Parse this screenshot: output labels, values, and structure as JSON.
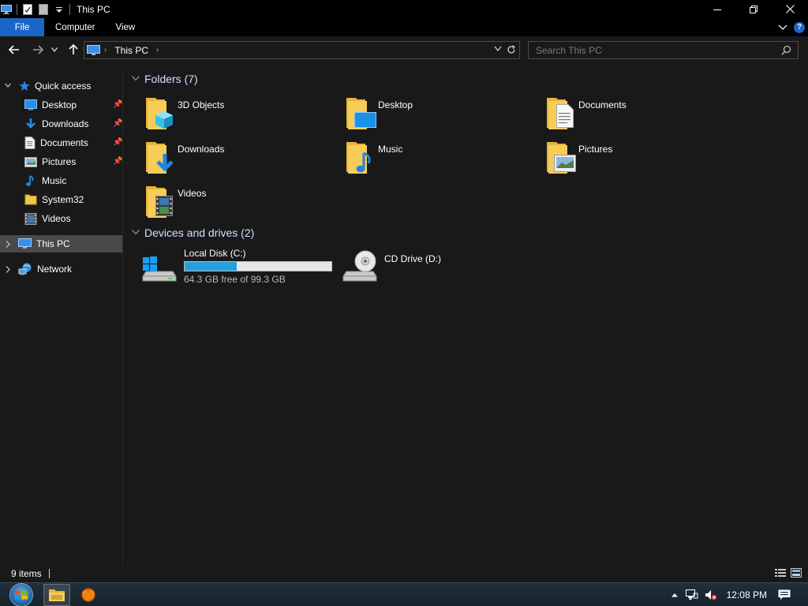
{
  "window": {
    "title": "This PC"
  },
  "ribbon": {
    "tabs": [
      "File",
      "Computer",
      "View"
    ]
  },
  "address": {
    "path": [
      "This PC"
    ]
  },
  "search": {
    "placeholder": "Search This PC"
  },
  "sidebar": {
    "quick_access": "Quick access",
    "items": [
      {
        "label": "Desktop",
        "icon": "desktop-icon",
        "pinned": true
      },
      {
        "label": "Downloads",
        "icon": "download-arrow-icon",
        "pinned": true
      },
      {
        "label": "Documents",
        "icon": "document-icon",
        "pinned": true
      },
      {
        "label": "Pictures",
        "icon": "picture-icon",
        "pinned": true
      },
      {
        "label": "Music",
        "icon": "music-note-icon",
        "pinned": false
      },
      {
        "label": "System32",
        "icon": "folder-icon",
        "pinned": false
      },
      {
        "label": "Videos",
        "icon": "film-icon",
        "pinned": false
      }
    ],
    "this_pc": "This PC",
    "network": "Network"
  },
  "content": {
    "folders_header": "Folders (7)",
    "folders": [
      {
        "label": "3D Objects",
        "overlay": "cube-icon"
      },
      {
        "label": "Desktop",
        "overlay": "desktop-icon"
      },
      {
        "label": "Documents",
        "overlay": "document-icon"
      },
      {
        "label": "Downloads",
        "overlay": "download-arrow-icon"
      },
      {
        "label": "Music",
        "overlay": "music-note-icon"
      },
      {
        "label": "Pictures",
        "overlay": "picture-icon"
      },
      {
        "label": "Videos",
        "overlay": "film-icon"
      }
    ],
    "drives_header": "Devices and drives (2)",
    "drives": [
      {
        "label": "Local Disk (C:)",
        "free_text": "64.3 GB free of 99.3 GB",
        "used_fraction": 0.353
      },
      {
        "label": "CD Drive (D:)"
      }
    ]
  },
  "status": {
    "items": "9 items"
  },
  "taskbar": {
    "clock": "12:08 PM"
  },
  "colors": {
    "accent": "#1a66c8",
    "folder": "#f3c34f",
    "background": "#191919",
    "bar_fill": "#26a0da"
  }
}
